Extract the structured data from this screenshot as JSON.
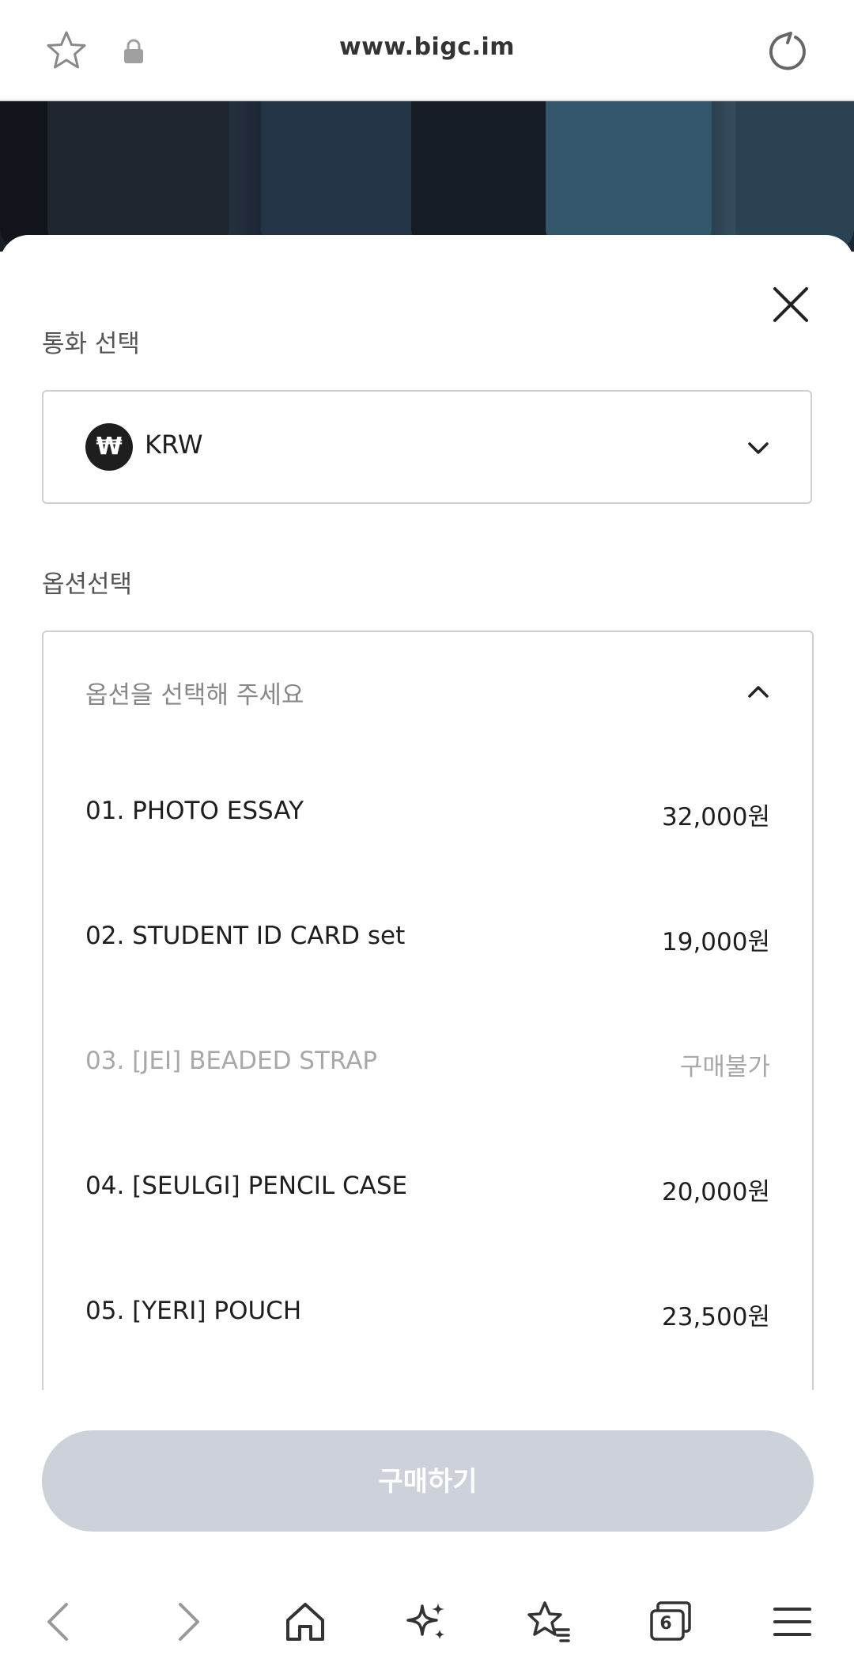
{
  "browser": {
    "url": "www.bigc.im"
  },
  "sheet": {
    "currency_label": "통화 선택",
    "currency_symbol": "₩",
    "currency_code": "KRW",
    "option_label": "옵션선택",
    "option_placeholder": "옵션을 선택해 주세요",
    "options": [
      {
        "name": "01. PHOTO ESSAY",
        "price": "32,000원",
        "available": true
      },
      {
        "name": "02. STUDENT ID CARD set",
        "price": "19,000원",
        "available": true
      },
      {
        "name": "03. [JEI] BEADED STRAP",
        "price": "구매불가",
        "available": false
      },
      {
        "name": "04. [SEULGI] PENCIL CASE",
        "price": "20,000원",
        "available": true
      },
      {
        "name": "05. [YERI] POUCH",
        "price": "23,500원",
        "available": true
      }
    ],
    "buy_label": "구매하기"
  },
  "bottom_nav": {
    "tab_count": "6",
    "icons": [
      "back-icon",
      "forward-icon",
      "home-icon",
      "sparkle-icon",
      "bookmarks-icon",
      "tabs-icon",
      "menu-icon"
    ]
  },
  "colors": {
    "buy_button": "#cdd1d9",
    "disabled_text": "#a8a8a8"
  }
}
